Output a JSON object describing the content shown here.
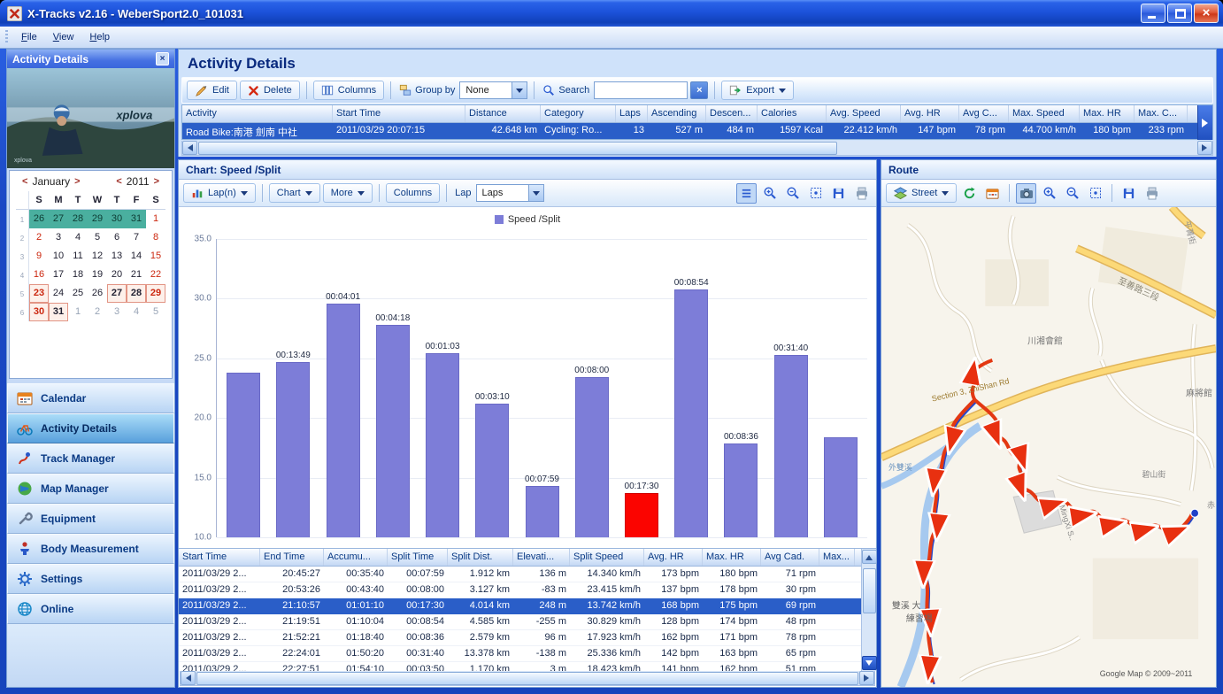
{
  "window": {
    "title": "X-Tracks v2.16 - WeberSport2.0_101031"
  },
  "menu_bar": {
    "items": [
      "File",
      "View",
      "Help"
    ]
  },
  "sidebar": {
    "panel_title": "Activity Details",
    "photo_brand": "xplova",
    "calendar": {
      "month": "January",
      "year": "2011",
      "prev_arrow": "<",
      "next_arrow": ">",
      "day_headers": [
        "S",
        "M",
        "T",
        "W",
        "T",
        "F",
        "S"
      ],
      "week_numbers": [
        "1",
        "2",
        "3",
        "4",
        "5",
        "6"
      ],
      "weeks": [
        [
          {
            "d": "26",
            "c": "dim sel"
          },
          {
            "d": "27",
            "c": "dim sel"
          },
          {
            "d": "28",
            "c": "dim sel"
          },
          {
            "d": "29",
            "c": "dim sel"
          },
          {
            "d": "30",
            "c": "dim sel"
          },
          {
            "d": "31",
            "c": "dim sel"
          },
          {
            "d": "1",
            "c": "red"
          }
        ],
        [
          {
            "d": "2",
            "c": "red"
          },
          {
            "d": "3",
            "c": ""
          },
          {
            "d": "4",
            "c": ""
          },
          {
            "d": "5",
            "c": ""
          },
          {
            "d": "6",
            "c": ""
          },
          {
            "d": "7",
            "c": ""
          },
          {
            "d": "8",
            "c": "red"
          }
        ],
        [
          {
            "d": "9",
            "c": "red"
          },
          {
            "d": "10",
            "c": ""
          },
          {
            "d": "11",
            "c": ""
          },
          {
            "d": "12",
            "c": ""
          },
          {
            "d": "13",
            "c": ""
          },
          {
            "d": "14",
            "c": ""
          },
          {
            "d": "15",
            "c": "red"
          }
        ],
        [
          {
            "d": "16",
            "c": "red"
          },
          {
            "d": "17",
            "c": ""
          },
          {
            "d": "18",
            "c": ""
          },
          {
            "d": "19",
            "c": ""
          },
          {
            "d": "20",
            "c": ""
          },
          {
            "d": "21",
            "c": ""
          },
          {
            "d": "22",
            "c": "red"
          }
        ],
        [
          {
            "d": "23",
            "c": "red box"
          },
          {
            "d": "24",
            "c": ""
          },
          {
            "d": "25",
            "c": ""
          },
          {
            "d": "26",
            "c": ""
          },
          {
            "d": "27",
            "c": "bold box"
          },
          {
            "d": "28",
            "c": "bold box"
          },
          {
            "d": "29",
            "c": "red box"
          }
        ],
        [
          {
            "d": "30",
            "c": "red box"
          },
          {
            "d": "31",
            "c": "bold box"
          },
          {
            "d": "1",
            "c": "dim"
          },
          {
            "d": "2",
            "c": "dim"
          },
          {
            "d": "3",
            "c": "dim"
          },
          {
            "d": "4",
            "c": "dim"
          },
          {
            "d": "5",
            "c": "dim"
          }
        ]
      ]
    },
    "nav_items": [
      {
        "label": "Calendar",
        "icon": "calendar-icon",
        "active": false
      },
      {
        "label": "Activity Details",
        "icon": "activity-icon",
        "active": true
      },
      {
        "label": "Track Manager",
        "icon": "track-icon",
        "active": false
      },
      {
        "label": "Map Manager",
        "icon": "map-icon",
        "active": false
      },
      {
        "label": "Equipment",
        "icon": "equipment-icon",
        "active": false
      },
      {
        "label": "Body Measurement",
        "icon": "body-icon",
        "active": false
      },
      {
        "label": "Settings",
        "icon": "settings-icon",
        "active": false
      },
      {
        "label": "Online",
        "icon": "online-icon",
        "active": false
      }
    ]
  },
  "main": {
    "title": "Activity Details",
    "toolbar": {
      "edit": "Edit",
      "delete": "Delete",
      "columns": "Columns",
      "group_by_label": "Group by",
      "group_by_value": "None",
      "search_label": "Search",
      "search_value": "",
      "export": "Export"
    },
    "activity_table": {
      "columns": [
        "Activity",
        "Start Time",
        "Distance",
        "Category",
        "Laps",
        "Ascending",
        "Descen...",
        "Calories",
        "Avg. Speed",
        "Avg. HR",
        "Avg C...",
        "Max. Speed",
        "Max. HR",
        "Max. C..."
      ],
      "row": [
        "Road Bike:南港 劍南 中社",
        "2011/03/29 20:07:15",
        "42.648 km",
        "Cycling: Ro...",
        "13",
        "527 m",
        "484 m",
        "1597 Kcal",
        "22.412 km/h",
        "147 bpm",
        "78 rpm",
        "44.700 km/h",
        "180 bpm",
        "233 rpm"
      ],
      "row_selected": true
    }
  },
  "chart_panel": {
    "title": "Chart: Speed /Split",
    "toolbar": {
      "lap_n": "Lap(n)",
      "chart": "Chart",
      "more": "More",
      "columns": "Columns",
      "lap_label": "Lap",
      "lap_value": "Laps"
    }
  },
  "chart_data": {
    "type": "bar",
    "title": "Speed /Split",
    "legend": [
      "Speed /Split"
    ],
    "ylabel": "",
    "xlabel": "",
    "ylim": [
      10.0,
      35.0
    ],
    "yticks": [
      35.0,
      30.0,
      25.0,
      20.0,
      15.0,
      10.0
    ],
    "grid": true,
    "legend_position": "top-center",
    "bar_color": "#7d7dd8",
    "highlight_color": "#fb0400",
    "bars": [
      {
        "label": "",
        "value": 23.8,
        "highlight": false
      },
      {
        "label": "00:13:49",
        "value": 24.7,
        "highlight": false
      },
      {
        "label": "00:04:01",
        "value": 29.6,
        "highlight": false
      },
      {
        "label": "00:04:18",
        "value": 27.8,
        "highlight": false
      },
      {
        "label": "00:01:03",
        "value": 25.4,
        "highlight": false
      },
      {
        "label": "00:03:10",
        "value": 21.2,
        "highlight": false
      },
      {
        "label": "00:07:59",
        "value": 14.3,
        "highlight": false
      },
      {
        "label": "00:08:00",
        "value": 23.4,
        "highlight": false
      },
      {
        "label": "00:17:30",
        "value": 13.7,
        "highlight": true
      },
      {
        "label": "00:08:54",
        "value": 30.8,
        "highlight": false
      },
      {
        "label": "00:08:36",
        "value": 17.9,
        "highlight": false
      },
      {
        "label": "00:31:40",
        "value": 25.3,
        "highlight": false
      },
      {
        "label": "",
        "value": 18.4,
        "highlight": false
      }
    ]
  },
  "splits_table": {
    "columns": [
      "Start Time",
      "End Time",
      "Accumu...",
      "Split Time",
      "Split Dist.",
      "Elevati...",
      "Split Speed",
      "Avg. HR",
      "Max. HR",
      "Avg Cad.",
      "Max..."
    ],
    "rows": [
      {
        "cells": [
          "2011/03/29 2...",
          "20:45:27",
          "00:35:40",
          "00:07:59",
          "1.912 km",
          "136 m",
          "14.340 km/h",
          "173 bpm",
          "180 bpm",
          "71 rpm",
          ""
        ],
        "selected": false
      },
      {
        "cells": [
          "2011/03/29 2...",
          "20:53:26",
          "00:43:40",
          "00:08:00",
          "3.127 km",
          "-83 m",
          "23.415 km/h",
          "137 bpm",
          "178 bpm",
          "30 rpm",
          ""
        ],
        "selected": false
      },
      {
        "cells": [
          "2011/03/29 2...",
          "21:10:57",
          "01:01:10",
          "00:17:30",
          "4.014 km",
          "248 m",
          "13.742 km/h",
          "168 bpm",
          "175 bpm",
          "69 rpm",
          ""
        ],
        "selected": true
      },
      {
        "cells": [
          "2011/03/29 2...",
          "21:19:51",
          "01:10:04",
          "00:08:54",
          "4.585 km",
          "-255 m",
          "30.829 km/h",
          "128 bpm",
          "174 bpm",
          "48 rpm",
          ""
        ],
        "selected": false
      },
      {
        "cells": [
          "2011/03/29 2...",
          "21:52:21",
          "01:18:40",
          "00:08:36",
          "2.579 km",
          "96 m",
          "17.923 km/h",
          "162 bpm",
          "171 bpm",
          "78 rpm",
          ""
        ],
        "selected": false
      },
      {
        "cells": [
          "2011/03/29 2...",
          "22:24:01",
          "01:50:20",
          "00:31:40",
          "13.378 km",
          "-138 m",
          "25.336 km/h",
          "142 bpm",
          "163 bpm",
          "65 rpm",
          ""
        ],
        "selected": false
      },
      {
        "cells": [
          "2011/03/29 2...",
          "22:27:51",
          "01:54:10",
          "00:03:50",
          "1.170 km",
          "3 m",
          "18.423 km/h",
          "141 bpm",
          "162 bpm",
          "51 rpm",
          ""
        ],
        "selected": false
      }
    ]
  },
  "route_panel": {
    "title": "Route",
    "toolbar": {
      "street": "Street"
    },
    "map_labels": [
      "平菁街",
      "至善路三段",
      "川湘會館",
      "麻將館",
      "Section 3, ZhiShan Rd",
      "外雙溪",
      "MingXi S..",
      "碧山街",
      "雙溪 大",
      "練習場",
      "Google Map © 2009~2011",
      "赤"
    ]
  },
  "colors": {
    "selection": "#2a5ec8",
    "bar": "#7d7dd8",
    "bar_highlight": "#fb0400",
    "calendar_selection": "#4aaf9f"
  }
}
